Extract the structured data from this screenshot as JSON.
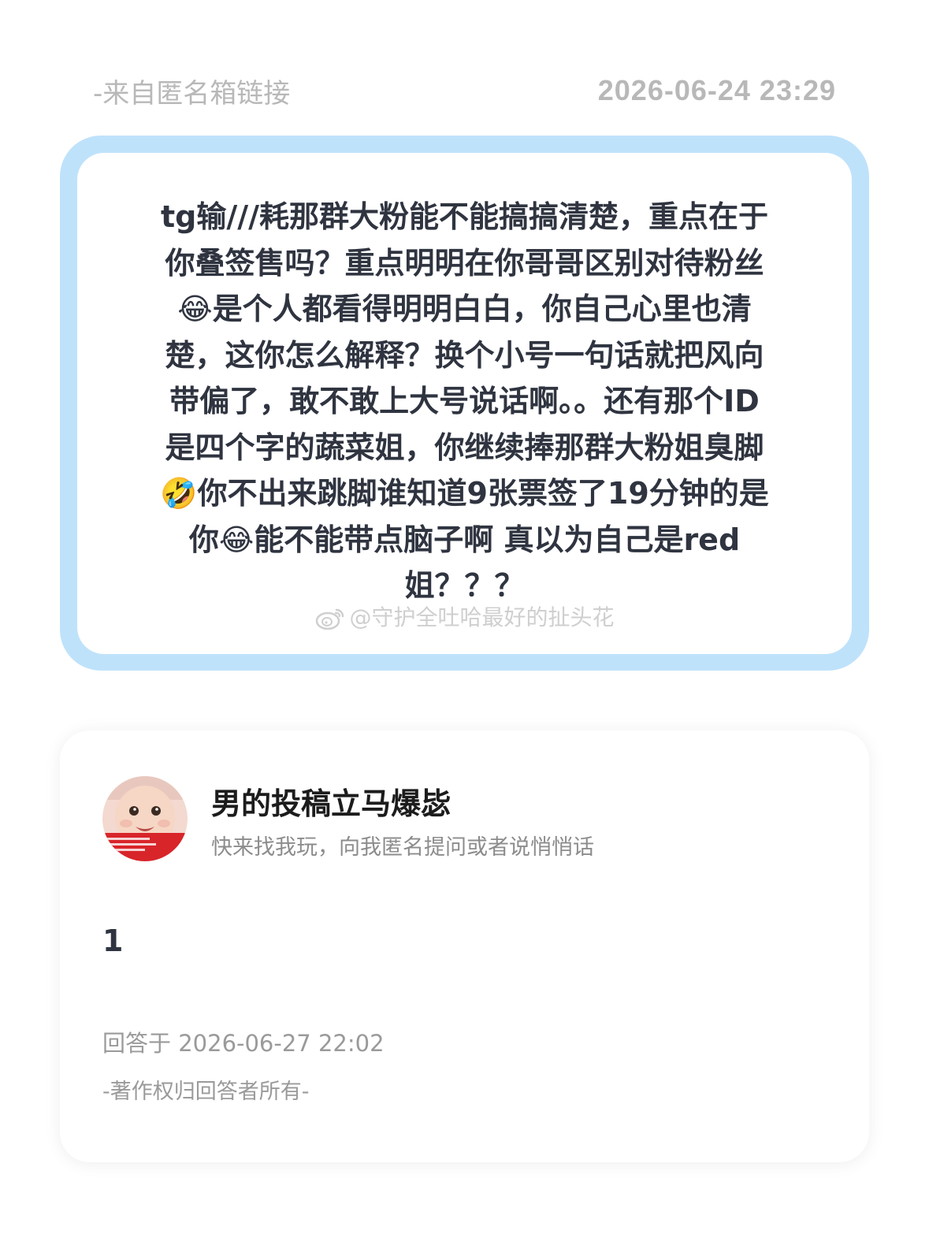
{
  "header": {
    "source_label": "-来自匿名箱链接",
    "timestamp": "2026-06-24 23:29"
  },
  "question": {
    "text": "tg输///耗那群大粉能不能搞搞清楚，重点在于\n你叠签售吗？重点明明在你哥哥区别对待粉丝\n😂是个人都看得明明白白，你自己心里也清\n楚，这你怎么解释？换个小号一句话就把风向\n带偏了，敢不敢上大号说话啊。。还有那个ID\n是四个字的蔬菜姐，你继续捧那群大粉姐臭脚\n🤣你不出来跳脚谁知道9张票签了19分钟的是\n你😂能不能带点脑子啊 真以为自己是red\n姐？？？"
  },
  "watermark": {
    "text": "@守护全吐哈最好的扯头花",
    "icon": "weibo-icon"
  },
  "answer": {
    "author_name": "男的投稿立马爆毖",
    "author_bio": "快来找我玩，向我匿名提问或者说悄悄话",
    "avatar_icon": "baby-face-avatar",
    "body": "1",
    "answered_at": "回答于 2026-06-27 22:02",
    "copyright": "-著作权归回答者所有-"
  },
  "colors": {
    "frame_blue": "#bfe2fb",
    "question_text": "#2f3440",
    "meta_gray": "#b8b8b8"
  }
}
